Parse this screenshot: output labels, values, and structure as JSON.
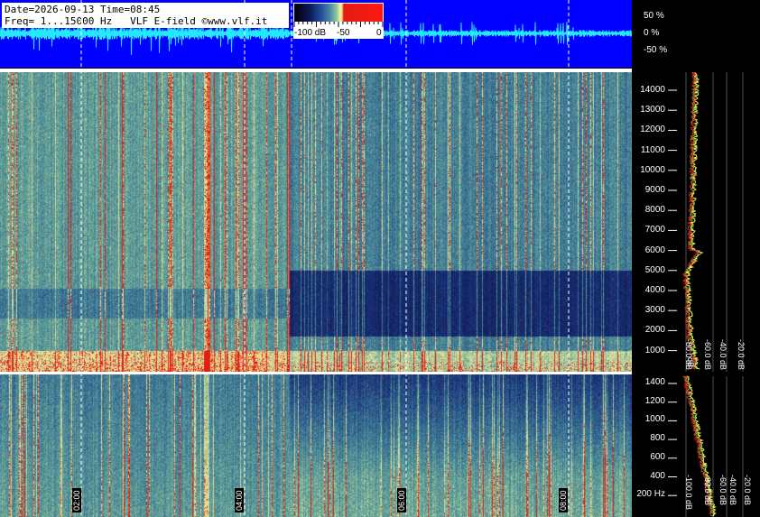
{
  "header": {
    "line1": "Date=2026-09-13 Time=08:45",
    "line2": "Freq= 1...15000 Hz   VLF E-field ©www.vlf.it"
  },
  "colorbar": {
    "labels": [
      "-100 dB",
      "-50",
      "0"
    ]
  },
  "waveform": {
    "percent_labels": [
      "50 %",
      "0 %",
      "-50 %"
    ]
  },
  "upper_freq_labels": [
    "14000",
    "13000",
    "12000",
    "11000",
    "10000",
    "9000",
    "8000",
    "7000",
    "6000",
    "5000",
    "4000",
    "3000",
    "2000",
    "1000"
  ],
  "lower_freq_labels": [
    "1400",
    "1200",
    "1000",
    "800",
    "600",
    "400",
    "200 Hz"
  ],
  "upper_db_labels": [
    "dB",
    "-80.0 dB",
    "-60.0 dB",
    "-40.0 dB",
    "-20.0 dB"
  ],
  "lower_db_labels": [
    "-100.0 dB",
    "-80.0 dB",
    "-60.0 dB",
    "-40.0 dB",
    "-20.0 dB"
  ],
  "time_labels": [
    "02:00",
    "04:00",
    "06:00",
    "08:00"
  ],
  "colors": {
    "waveform_bg": "#0000ff",
    "waveform_trace": "#27e6ff",
    "spectro_dark": "#172a73",
    "spectro_light": "#5e9f9e",
    "hot": "#e3241b",
    "spectrum_green": "#35e43a",
    "spectrum_red": "#e42222",
    "spectrum_yellow": "#f3f064"
  }
}
